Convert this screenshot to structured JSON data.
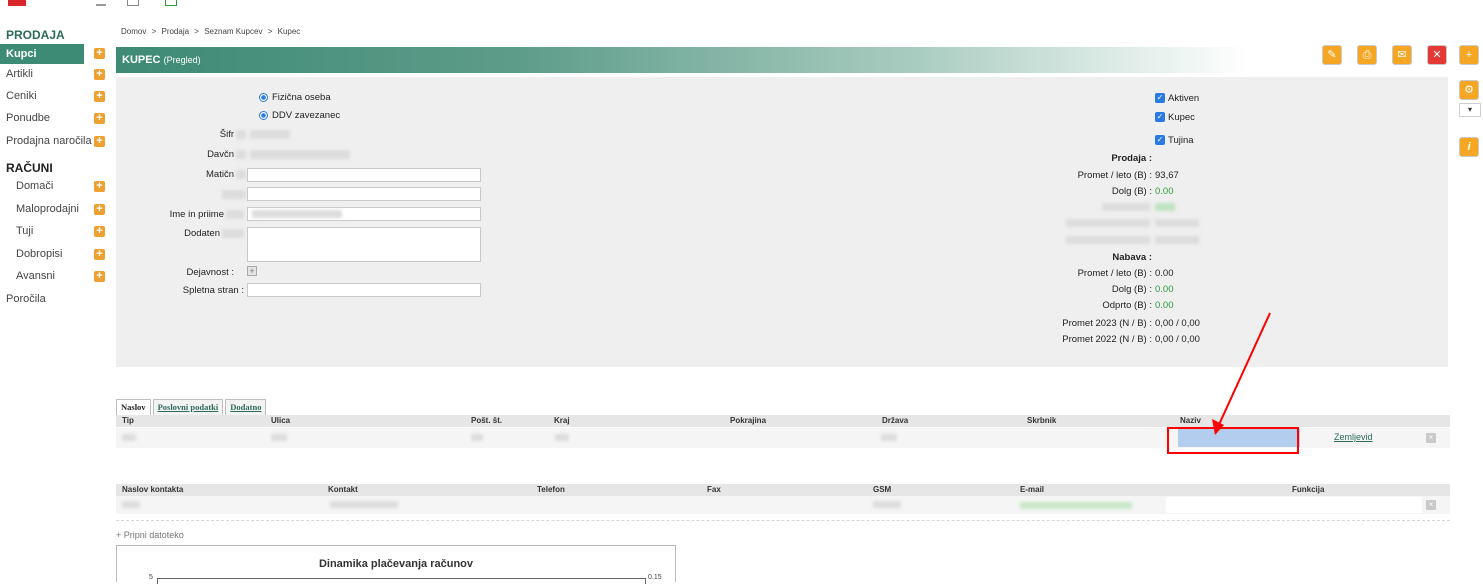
{
  "sidebar": {
    "section_prodaja": "PRODAJA",
    "items_prodaja": [
      {
        "label": "Kupci",
        "active": true
      },
      {
        "label": "Artikli"
      },
      {
        "label": "Ceniki"
      },
      {
        "label": "Ponudbe"
      },
      {
        "label": "Prodajna naročila"
      }
    ],
    "section_racuni": "RAČUNI",
    "items_racuni": [
      {
        "label": "Domači"
      },
      {
        "label": "Maloprodajni"
      },
      {
        "label": "Tuji"
      },
      {
        "label": "Dobropisi"
      },
      {
        "label": "Avansni"
      }
    ],
    "porocila": "Poročila",
    "plus_glyph": "+"
  },
  "breadcrumb": {
    "items": [
      "Domov",
      "Prodaja",
      "Seznam Kupcev",
      "Kupec"
    ],
    "separator": ">"
  },
  "header": {
    "title": "KUPEC",
    "subtitle": "(Pregled)"
  },
  "toolbar": {
    "icons": [
      "edit-icon",
      "print-icon",
      "mail-icon",
      "close-icon",
      "add-icon"
    ],
    "glyphs": [
      "✎",
      "⎙",
      "✉",
      "✕",
      "+"
    ],
    "side_icons": [
      "settings-icon",
      "info-icon"
    ],
    "side_glyphs": [
      "⚙",
      "i"
    ],
    "dropdown_glyph": "▾"
  },
  "form": {
    "radio_fizicna": "Fizična oseba",
    "radio_ddv": "DDV zavezanec",
    "label_sifra": "Šifr",
    "label_davcna": "Davčn",
    "label_maticna": "Matičn",
    "label_ime": "Ime in priime",
    "label_dodaten": "Dodaten",
    "label_dejavnost": "Dejavnost :",
    "label_spletna": "Spletna stran :",
    "dejavnost_glyph": "+"
  },
  "status": {
    "aktiven": "Aktiven",
    "kupec": "Kupec",
    "tujina": "Tujina",
    "check_glyph": "✓"
  },
  "prodaja": {
    "heading": "Prodaja :",
    "promet_label": "Promet / leto (B) :",
    "promet_value": "93,67",
    "dolg_label": "Dolg (B) :",
    "dolg_value": "0.00"
  },
  "nabava": {
    "heading": "Nabava :",
    "promet_label": "Promet / leto (B) :",
    "promet_value": "0.00",
    "dolg_label": "Dolg (B) :",
    "dolg_value": "0.00",
    "odprto_label": "Odprto (B) :",
    "odprto_value": "0.00",
    "p2023_label": "Promet 2023 (N / B) :",
    "p2023_value": "0,00 / 0,00",
    "p2022_label": "Promet 2022 (N / B) :",
    "p2022_value": "0,00 / 0,00"
  },
  "tabs": [
    "Naslov",
    "Poslovni podatki",
    "Dodatno"
  ],
  "address_table": {
    "headers": [
      "Tip",
      "Ulica",
      "Pošt. št.",
      "Kraj",
      "Pokrajina",
      "Država",
      "Skrbnik",
      "Naziv"
    ],
    "row_link": "Zemljevid",
    "x_glyph": "×"
  },
  "contact_table": {
    "headers": [
      "Naslov kontakta",
      "Kontakt",
      "Telefon",
      "Fax",
      "GSM",
      "E-mail",
      "Funkcija"
    ],
    "x_glyph": "×"
  },
  "attach_link": "+ Pripni datoteko",
  "chart_data": {
    "type": "line",
    "title": "Dinamika plačevanja računov",
    "y_left_top": "5",
    "y_right_top": "0.15"
  },
  "colors": {
    "accent": "#3d8a75",
    "annotation": "#ff0000",
    "highlight_cell": "#b3cdee"
  }
}
